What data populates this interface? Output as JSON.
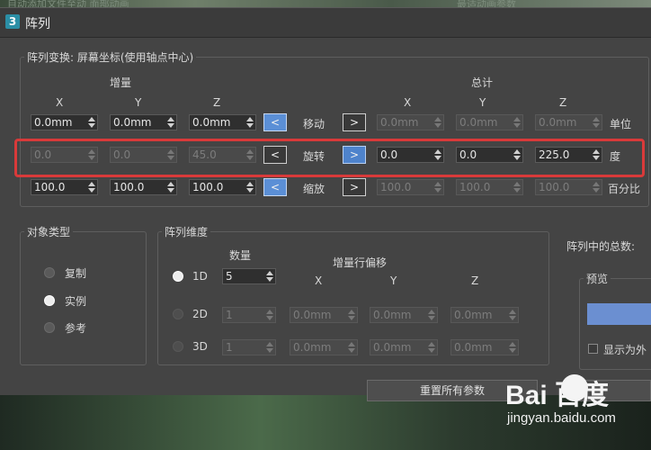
{
  "background": {
    "top_text_1": "自动添加文件至动 面部动画",
    "top_text_2": "最适动画参数"
  },
  "window": {
    "icon": "3",
    "title": "阵列"
  },
  "transform": {
    "title": "阵列变换: 屏幕坐标(使用轴点中心)",
    "increment_label": "增量",
    "total_label": "总计",
    "axes": {
      "x": "X",
      "y": "Y",
      "z": "Z"
    },
    "move": {
      "label": "移动",
      "inc": [
        "0.0mm",
        "0.0mm",
        "0.0mm"
      ],
      "total": [
        "0.0mm",
        "0.0mm",
        "0.0mm"
      ],
      "unit": "单位"
    },
    "rotate": {
      "label": "旋转",
      "inc": [
        "0.0",
        "0.0",
        "45.0"
      ],
      "total": [
        "0.0",
        "0.0",
        "225.0"
      ],
      "unit": "度"
    },
    "scale": {
      "label": "缩放",
      "inc": [
        "100.0",
        "100.0",
        "100.0"
      ],
      "total": [
        "100.0",
        "100.0",
        "100.0"
      ],
      "unit": "百分比"
    },
    "left_arrow": "<",
    "right_arrow": ">"
  },
  "object_type": {
    "title": "对象类型",
    "options": [
      "复制",
      "实例",
      "参考"
    ],
    "selected": "实例"
  },
  "array_dim": {
    "title": "阵列维度",
    "count_label": "数量",
    "offset_label": "增量行偏移",
    "axes": {
      "x": "X",
      "y": "Y",
      "z": "Z"
    },
    "rows": [
      {
        "label": "1D",
        "count": "5"
      },
      {
        "label": "2D",
        "count": "1",
        "x": "0.0mm",
        "y": "0.0mm",
        "z": "0.0mm"
      },
      {
        "label": "3D",
        "count": "1",
        "x": "0.0mm",
        "y": "0.0mm",
        "z": "0.0mm"
      }
    ],
    "selected": "1D"
  },
  "total_in_array_label": "阵列中的总数:",
  "preview": {
    "title": "预览",
    "show_as": "显示为外"
  },
  "reset_button": "重置所有参数",
  "watermark": {
    "logo": "Bai  百度",
    "url": "jingyan.baidu.com"
  }
}
